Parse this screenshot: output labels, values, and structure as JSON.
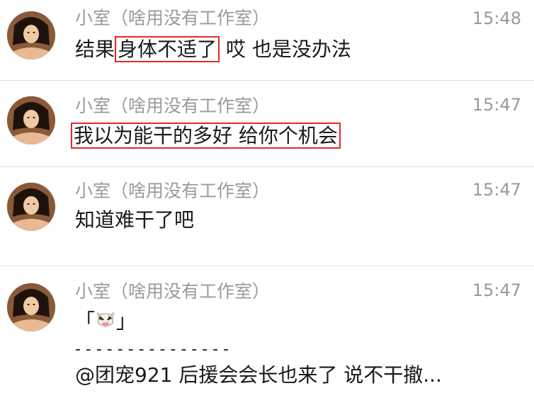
{
  "messages": [
    {
      "sender": "小室（啥用没有工作室）",
      "time": "15:48",
      "text_before": "结果",
      "highlight": "身体不适了",
      "text_after": " 哎 也是没办法"
    },
    {
      "sender": "小室（啥用没有工作室）",
      "time": "15:47",
      "highlight": "我以为能干的多好 给你个机会"
    },
    {
      "sender": "小室（啥用没有工作室）",
      "time": "15:47",
      "text": "知道难干了吧"
    },
    {
      "sender": "小室（啥用没有工作室）",
      "time": "15:47",
      "line1_open": "「",
      "line1_close": "」",
      "line1_icon": "cow-emoji",
      "line2": "- - - - - - - - - - - - - - -",
      "line3": "@团宠921 后援会会长也来了 说不干撤..."
    }
  ],
  "colors": {
    "highlight_border": "#e12a2a",
    "meta_text": "#9a9a9a",
    "body_text": "#1a1a1a",
    "divider": "#dedede"
  }
}
